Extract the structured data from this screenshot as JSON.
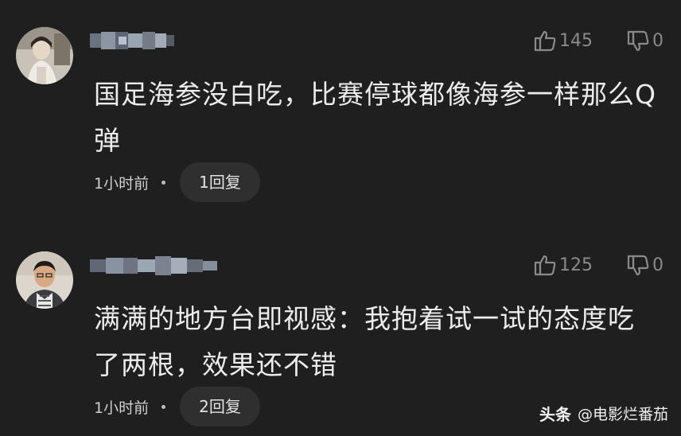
{
  "comments": [
    {
      "likes": "145",
      "dislikes": "0",
      "text": "国足海参没白吃，比赛停球都像海参一样那么Q弹",
      "time": "1小时前",
      "reply": "1回复"
    },
    {
      "likes": "125",
      "dislikes": "0",
      "text": "满满的地方台即视感：我抱着试一试的态度吃了两根，效果还不错",
      "time": "1小时前",
      "reply": "2回复"
    }
  ],
  "watermark": {
    "brand": "头条",
    "handle": "@电影烂番茄"
  },
  "icons": {
    "like": "thumbs-up-icon",
    "dislike": "thumbs-down-icon"
  }
}
